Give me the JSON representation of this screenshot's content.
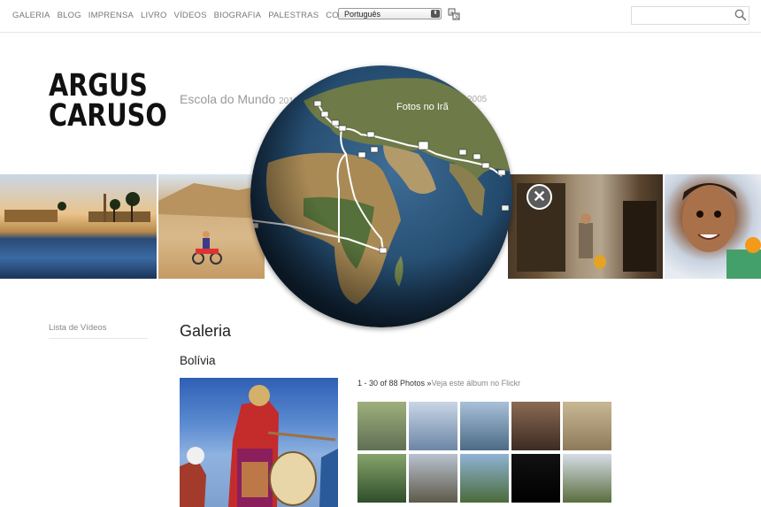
{
  "nav": {
    "items": [
      "GALERIA",
      "BLOG",
      "IMPRENSA",
      "LIVRO",
      "VÍDEOS",
      "BIOGRAFIA",
      "PALESTRAS",
      "CONTATO"
    ]
  },
  "language": {
    "selected": "Português"
  },
  "search": {
    "value": "",
    "placeholder": ""
  },
  "logo": {
    "line1": "ARGUS",
    "line2": "CARUSO"
  },
  "tagline": {
    "text": "Escola do Mundo",
    "year_start": "2010",
    "year_end": "2005"
  },
  "globe": {
    "label": "Fotos no Irã"
  },
  "sidebar": {
    "videos_link": "Lista de Vídeos"
  },
  "gallery": {
    "heading": "Galeria",
    "album": "Bolívia",
    "count_text": "1 - 30 of 88 Photos »",
    "flickr_link": "Veja este álbum no Flickr"
  },
  "thumbnails": [
    {
      "colors": [
        "#9eb07c",
        "#5f6f54"
      ]
    },
    {
      "colors": [
        "#c9d6e6",
        "#6d86a6"
      ]
    },
    {
      "colors": [
        "#a9c0d8",
        "#4c6b86"
      ]
    },
    {
      "colors": [
        "#8a6b54",
        "#3c2b22"
      ]
    },
    {
      "colors": [
        "#c9b894",
        "#8d7a5a"
      ]
    },
    {
      "colors": [
        "#86a46b",
        "#2f4e2b"
      ]
    },
    {
      "colors": [
        "#b8c2cf",
        "#5e5a4a"
      ]
    },
    {
      "colors": [
        "#8fb3d4",
        "#4b6b3a"
      ]
    },
    {
      "colors": [
        "#111111",
        "#000000"
      ]
    },
    {
      "colors": [
        "#d6dde6",
        "#5a6e3f"
      ]
    }
  ]
}
